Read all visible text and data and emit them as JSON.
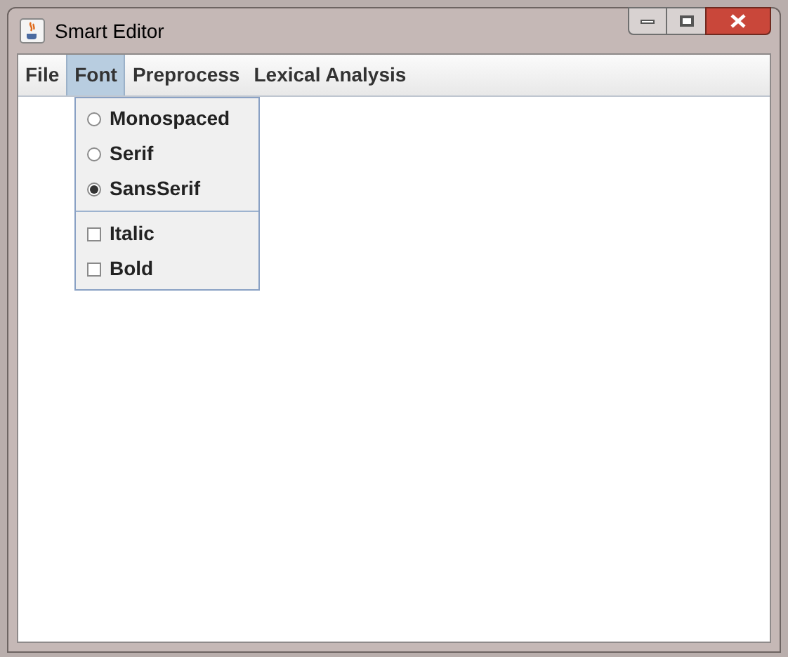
{
  "window": {
    "title": "Smart Editor"
  },
  "menu_bar": [
    {
      "label": "File",
      "selected": false
    },
    {
      "label": "Font",
      "selected": true
    },
    {
      "label": "Preprocess",
      "selected": false
    },
    {
      "label": "Lexical Analysis",
      "selected": false
    }
  ],
  "font_menu": {
    "items": [
      {
        "kind": "radio",
        "label": "Monospaced",
        "selected": false
      },
      {
        "kind": "radio",
        "label": "Serif",
        "selected": false
      },
      {
        "kind": "radio",
        "label": "SansSerif",
        "selected": true
      },
      {
        "kind": "separator"
      },
      {
        "kind": "check",
        "label": "Italic",
        "checked": false
      },
      {
        "kind": "check",
        "label": "Bold",
        "checked": false
      }
    ]
  }
}
